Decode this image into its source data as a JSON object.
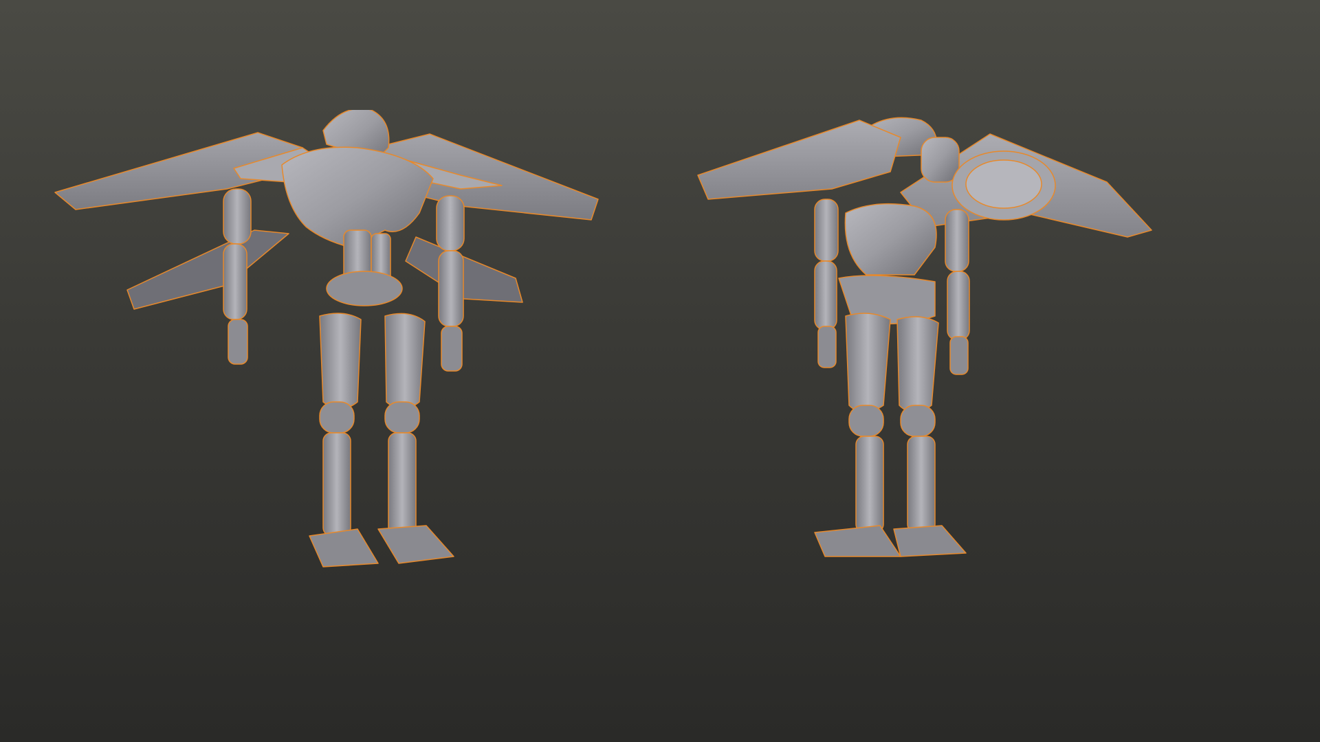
{
  "viewport": {
    "background_top": "#4a4a44",
    "background_bottom": "#2a2a28",
    "selection_outline_color": "#e8892a",
    "mesh_color": "#9d9da2"
  },
  "models": [
    {
      "name": "winged-robot",
      "view": "front-three-quarter",
      "selected": true
    },
    {
      "name": "winged-robot",
      "view": "back-three-quarter",
      "selected": true
    }
  ]
}
